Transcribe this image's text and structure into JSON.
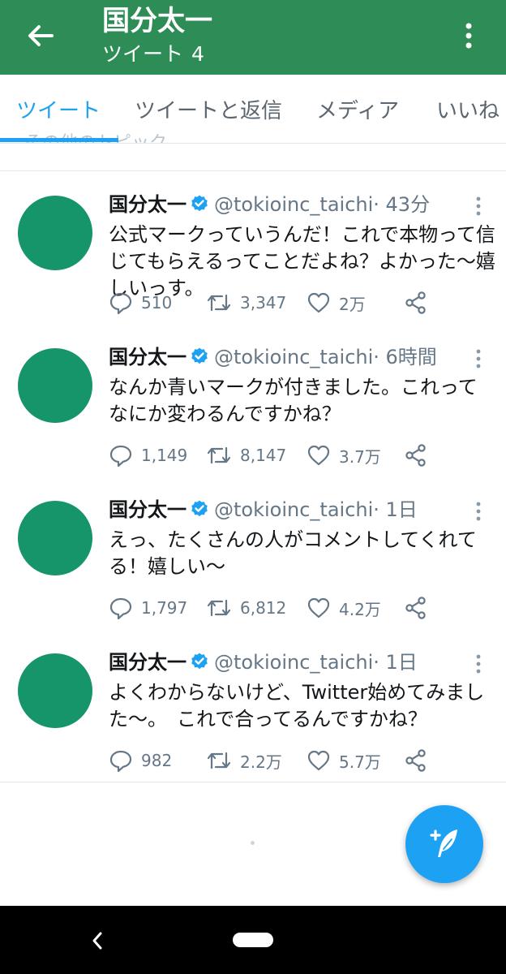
{
  "header": {
    "title": "国分太一",
    "subtitle_label": "ツイート",
    "subtitle_count": "4"
  },
  "tabs": [
    {
      "label": "ツイート",
      "active": true
    },
    {
      "label": "ツイートと返信",
      "active": false
    },
    {
      "label": "メディア",
      "active": false
    },
    {
      "label": "いいね",
      "active": false
    }
  ],
  "tabs_ghost_text": "その他のトピック",
  "tweets": [
    {
      "name": "国分太一",
      "handle": "@tokioinc_taichi",
      "time": "· 43分",
      "text": "公式マークっていうんだ！これで本物って信じてもらえるってことだよね？よかった〜嬉しいっす。",
      "replies": "510",
      "retweets": "3,347",
      "likes": "2万"
    },
    {
      "name": "国分太一",
      "handle": "@tokioinc_taichi",
      "time": "· 6時間",
      "text": "なんか青いマークが付きました。これってなにか変わるんですかね？",
      "replies": "1,149",
      "retweets": "8,147",
      "likes": "3.7万"
    },
    {
      "name": "国分太一",
      "handle": "@tokioinc_taichi",
      "time": "· 1日",
      "text": "えっ、たくさんの人がコメントしてくれてる！嬉しい〜",
      "replies": "1,797",
      "retweets": "6,812",
      "likes": "4.2万"
    },
    {
      "name": "国分太一",
      "handle": "@tokioinc_taichi",
      "time": "· 1日",
      "text": "よくわからないけど、Twitter始めてみました〜。　これで合ってるんですかね？",
      "replies": "982",
      "retweets": "2.2万",
      "likes": "5.7万"
    }
  ],
  "colors": {
    "header_bg": "#2e8c57",
    "accent": "#1da1f2",
    "avatar": "#16946a",
    "secondary_text": "#657786"
  },
  "icons": {
    "back": "arrow-left-icon",
    "more": "more-vert-icon",
    "verified": "verified-badge-icon",
    "reply": "reply-icon",
    "retweet": "retweet-icon",
    "like": "heart-icon",
    "share": "share-icon",
    "compose": "compose-tweet-icon"
  }
}
